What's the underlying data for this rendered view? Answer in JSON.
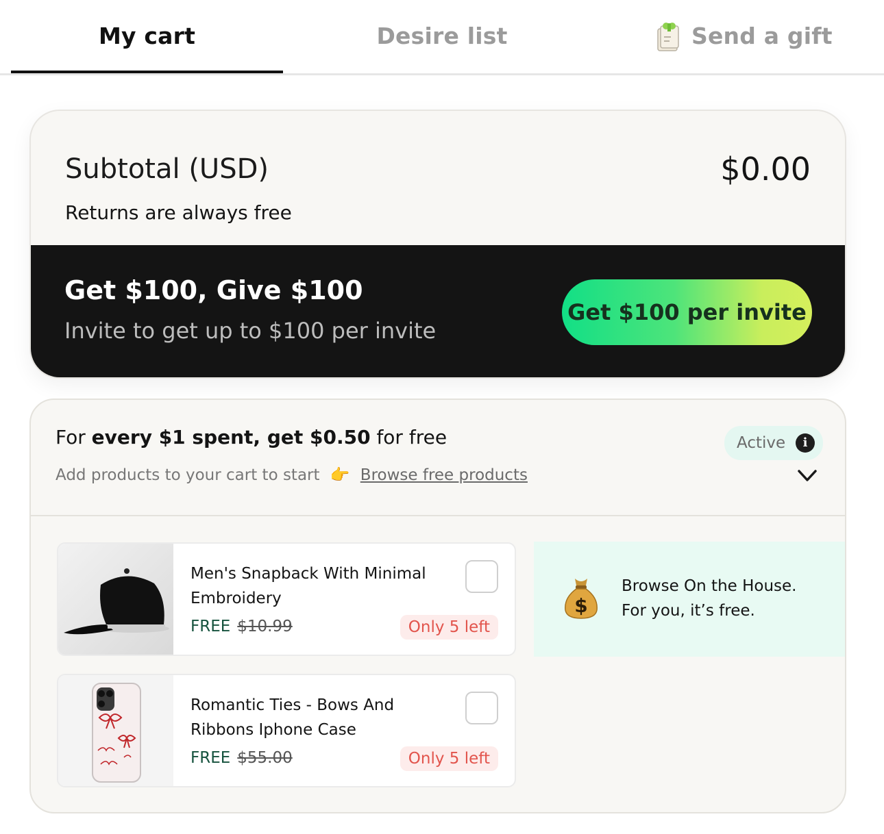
{
  "tabs": {
    "cart": "My cart",
    "desire": "Desire list",
    "gift": "Send a gift"
  },
  "subtotal": {
    "label": "Subtotal (USD)",
    "value": "$0.00",
    "returns": "Returns are always free"
  },
  "promo": {
    "title": "Get $100, Give $100",
    "subtitle": "Invite to get up to $100 per invite",
    "button": "Get $100 per invite"
  },
  "rewards": {
    "title_prefix": "For ",
    "title_bold": "every $1 spent, get $0.50",
    "title_suffix": " for free",
    "hint": "Add products to your cart to start",
    "hint_emoji": "👉",
    "link": "Browse free products",
    "status": "Active",
    "info_glyph": "i"
  },
  "products": [
    {
      "name": "Men's Snapback With Minimal Embroidery",
      "price": "FREE",
      "old_price": "$10.99",
      "stock": "Only 5 left"
    },
    {
      "name": "Romantic Ties - Bows And Ribbons Iphone Case",
      "price": "FREE",
      "old_price": "$55.00",
      "stock": "Only 5 left"
    }
  ],
  "house": {
    "line1": "Browse On the House.",
    "line2": "For you, it’s free.",
    "icon": "money-bag-icon"
  },
  "colors": {
    "accent_green": "#12df86",
    "accent_lime": "#d5ef5c",
    "promo_bg": "#141414",
    "badge_red": "#e2544c"
  }
}
